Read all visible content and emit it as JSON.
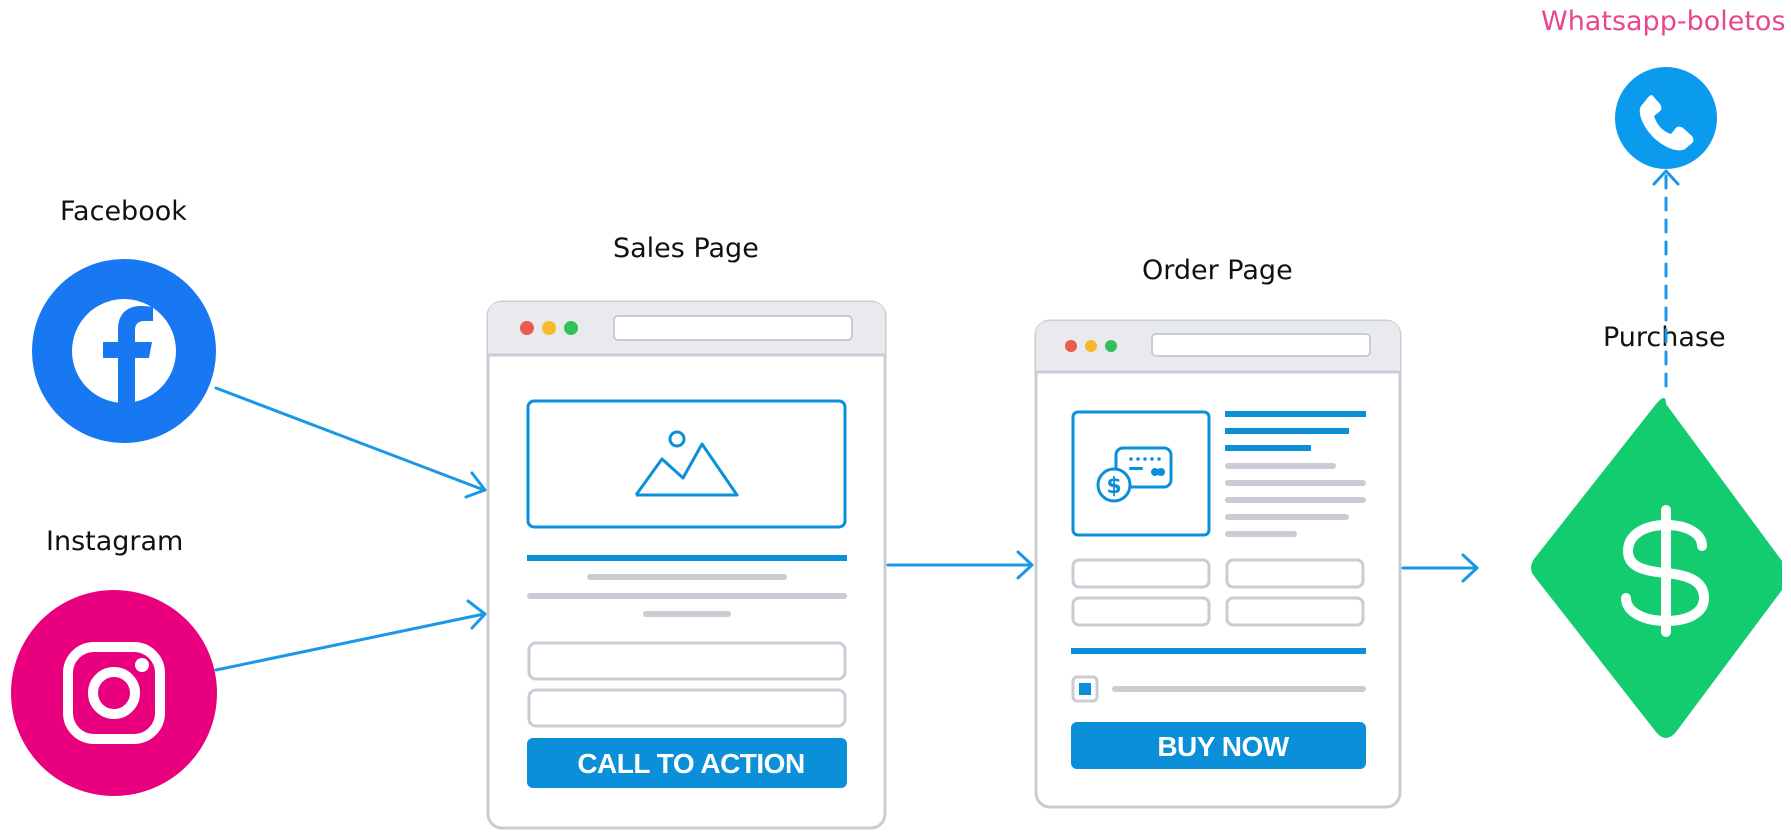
{
  "nodes": {
    "facebook": {
      "label": "Facebook",
      "icon": "facebook-icon",
      "color": "#1778f2"
    },
    "instagram": {
      "label": "Instagram",
      "icon": "instagram-icon",
      "color": "#e8007f"
    },
    "sales_page": {
      "label": "Sales Page",
      "button_label": "CALL TO ACTION"
    },
    "order_page": {
      "label": "Order Page",
      "button_label": "BUY NOW"
    },
    "purchase": {
      "label": "Purchase",
      "icon": "dollar-icon",
      "color": "#14cc70"
    },
    "whatsapp": {
      "label": "Whatsapp-boletos",
      "icon": "phone-icon",
      "color": "#0a9bef"
    }
  },
  "edges": [
    {
      "from": "facebook",
      "to": "sales_page",
      "style": "solid"
    },
    {
      "from": "instagram",
      "to": "sales_page",
      "style": "solid"
    },
    {
      "from": "sales_page",
      "to": "order_page",
      "style": "solid"
    },
    {
      "from": "order_page",
      "to": "purchase",
      "style": "solid"
    },
    {
      "from": "purchase",
      "to": "whatsapp",
      "style": "dashed"
    }
  ],
  "colors": {
    "arrow": "#1a98e6",
    "accent_blue": "#0a8fd8",
    "browser_border": "#c8ccd4",
    "placeholder_gray": "#c9ccd2"
  }
}
